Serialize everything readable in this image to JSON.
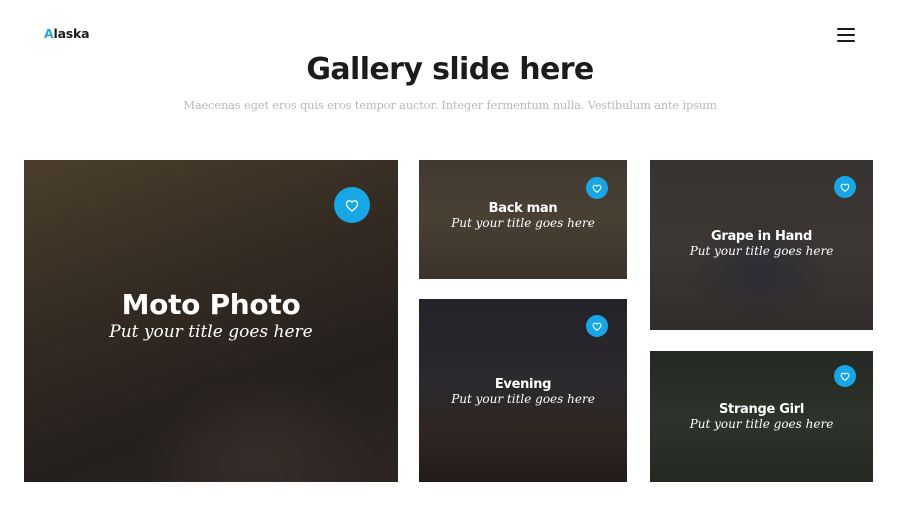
{
  "brand": {
    "first_letter": "A",
    "rest": "laska",
    "accent_color": "#1fa8e0"
  },
  "header": {
    "menu_icon": "hamburger-icon"
  },
  "hero": {
    "title": "Gallery slide here",
    "subtitle": "Maecenas eget eros quis eros tempor auctor. Integer fermentum nulla. Vestibulum ante ipsum"
  },
  "gallery": {
    "like_icon": "heart-icon",
    "like_color": "#18a6e6",
    "items": [
      {
        "title": "Moto Photo",
        "subtitle": "Put your title goes here"
      },
      {
        "title": "Back man",
        "subtitle": "Put your title goes here"
      },
      {
        "title": "Evening",
        "subtitle": "Put your title goes here"
      },
      {
        "title": "Grape in Hand",
        "subtitle": "Put your title goes here"
      },
      {
        "title": "Strange Girl",
        "subtitle": "Put your title goes here"
      }
    ]
  }
}
